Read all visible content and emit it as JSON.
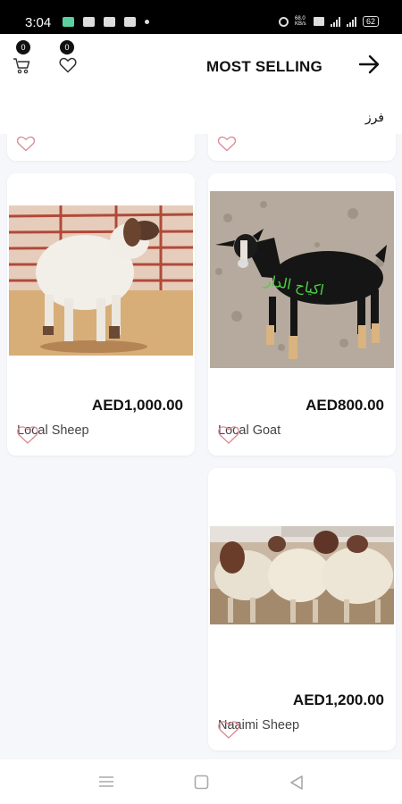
{
  "status_bar": {
    "time": "3:04",
    "network_speed": "68.0\nKB/s",
    "battery": "62"
  },
  "header": {
    "cart_count": "0",
    "favorites_count": "0",
    "title": "MOST SELLING",
    "sort_label": "فرز"
  },
  "products": [
    {
      "name": "Local Sheep",
      "price": "AED1,000.00",
      "image": "white sheep with brown face in pen"
    },
    {
      "name": "Local Goat",
      "price": "AED800.00",
      "image": "black goat on rocky ground with arabic watermark"
    },
    {
      "name": "Naaimi Sheep",
      "price": "AED1,200.00",
      "image": "flock of brown-headed sheep"
    }
  ],
  "image_watermark": "اكياح الدار",
  "nav": {
    "icons": [
      "menu-icon",
      "home-square-icon",
      "back-triangle-icon"
    ]
  }
}
